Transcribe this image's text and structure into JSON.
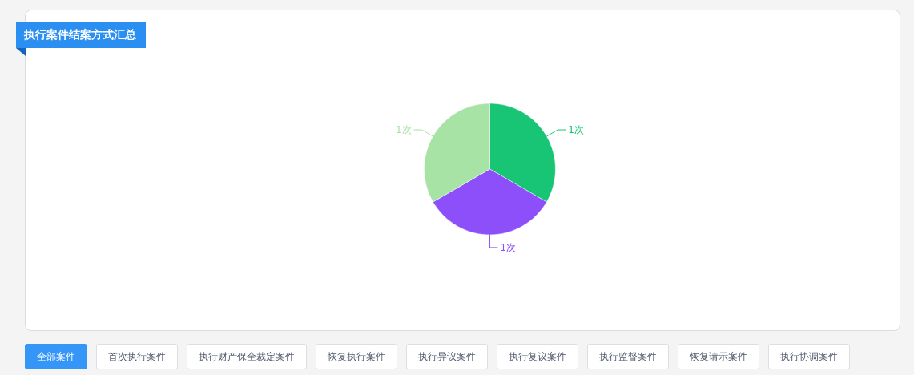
{
  "panel": {
    "title": "执行案件结案方式汇总",
    "chart_data": {
      "type": "pie",
      "values": [
        1,
        1,
        1
      ],
      "colors": [
        "#17c574",
        "#8c4ffa",
        "#a7e3a5"
      ],
      "value_labels": [
        "1次",
        "1次",
        "1次"
      ]
    }
  },
  "filters": [
    {
      "label": "全部案件",
      "selected": true
    },
    {
      "label": "首次执行案件",
      "selected": false
    },
    {
      "label": "执行财产保全裁定案件",
      "selected": false
    },
    {
      "label": "恢复执行案件",
      "selected": false
    },
    {
      "label": "执行异议案件",
      "selected": false
    },
    {
      "label": "执行复议案件",
      "selected": false
    },
    {
      "label": "执行监督案件",
      "selected": false
    },
    {
      "label": "恢复请示案件",
      "selected": false
    },
    {
      "label": "执行协调案件",
      "selected": false
    }
  ]
}
